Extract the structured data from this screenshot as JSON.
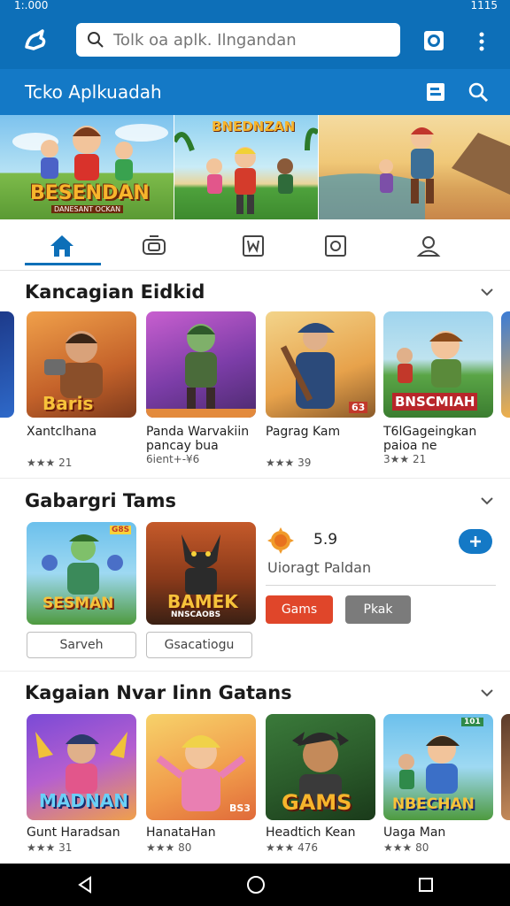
{
  "status": {
    "time": "1:.000",
    "right": "1115"
  },
  "search": {
    "placeholder": "Tolk oa aplk. Ilngandan"
  },
  "subheader": {
    "title": "Tcko Aplkuadah"
  },
  "banners": [
    {
      "logo": "BESENDAN",
      "sub": "DANESANT OCKAN"
    },
    {
      "logo": "BNEDNZAN"
    },
    {
      "logo": ""
    }
  ],
  "tabs": [
    "home",
    "games",
    "apps",
    "books",
    "account"
  ],
  "section1": {
    "title": "Kancagian Eidkid",
    "items": [
      {
        "name": "Xantclhana",
        "rating": "★★★ 21",
        "art": "Baris"
      },
      {
        "name": "Panda Warvakiin pancay bua",
        "rating": "6ient+-¥6",
        "art": ""
      },
      {
        "name": "Pagrag Kam",
        "rating": "★★★ 39",
        "art": "63"
      },
      {
        "name": "T6lGageingkan paioa ne",
        "rating": "3★★ 21",
        "art": "BNSCMIAH"
      }
    ]
  },
  "section2": {
    "title": "Gabargri Tams",
    "items": [
      {
        "art": "SESMAN",
        "badge": "G8S",
        "button": "Sarveh"
      },
      {
        "art": "BAMEK",
        "sub": "NNSCAOBS",
        "button": "Gsacatiogu"
      }
    ],
    "feature": {
      "rating": "5.9",
      "name": "Uioragt Paldan",
      "btn_primary": "Gams",
      "btn_secondary": "Pkak"
    }
  },
  "section3": {
    "title": "Kagaian Nvar Iinn Gatans",
    "items": [
      {
        "name": "Gunt Haradsan",
        "rating": "★★★ 31",
        "art": "MADNAN"
      },
      {
        "name": "HanataHan",
        "rating": "★★★ 80",
        "art": "BS3"
      },
      {
        "name": "Headtich Kean",
        "rating": "★★★ 476",
        "art": "GAMS"
      },
      {
        "name": "Uaga Man",
        "rating": "★★★ 80",
        "art": "NBECHAN",
        "badge": "101"
      }
    ]
  },
  "colors": {
    "primary": "#0d6fb8",
    "accent": "#e0462a",
    "grey_btn": "#7b7b7b"
  }
}
